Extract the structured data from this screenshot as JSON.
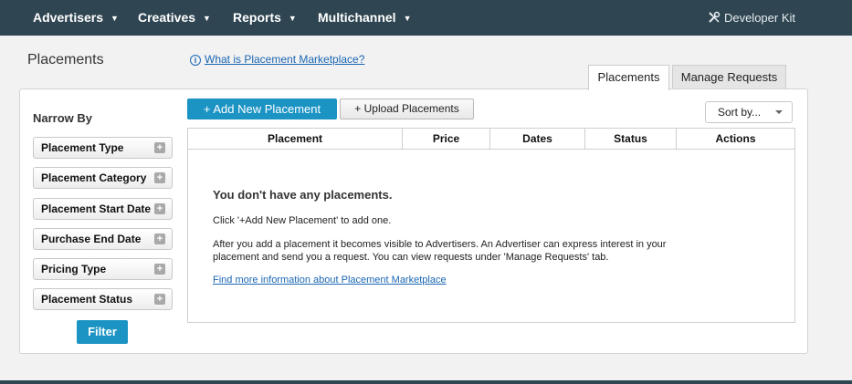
{
  "nav": {
    "items": [
      {
        "label": "Advertisers"
      },
      {
        "label": "Creatives"
      },
      {
        "label": "Reports"
      },
      {
        "label": "Multichannel"
      }
    ],
    "caret": "▼",
    "developer_kit": "Developer Kit"
  },
  "page": {
    "title": "Placements",
    "help_link": "What is Placement Marketplace?"
  },
  "tabs": [
    {
      "label": "Placements",
      "active": true
    },
    {
      "label": "Manage Requests",
      "active": false
    }
  ],
  "sidebar": {
    "title": "Narrow By",
    "filters": [
      {
        "label": "Placement Type"
      },
      {
        "label": "Placement Category"
      },
      {
        "label": "Placement Start Date"
      },
      {
        "label": "Purchase End Date"
      },
      {
        "label": "Pricing Type"
      },
      {
        "label": "Placement Status"
      }
    ],
    "plus": "+",
    "filter_button": "Filter"
  },
  "toolbar": {
    "add_button": "+ Add New Placement",
    "upload_button": "+ Upload Placements",
    "sort_label": "Sort by..."
  },
  "table": {
    "columns": [
      "Placement",
      "Price",
      "Dates",
      "Status",
      "Actions"
    ]
  },
  "empty_state": {
    "title": "You don't have any placements.",
    "line1": "Click '+Add New Placement' to add one.",
    "line2a": "After you add a placement it becomes visible to Advertisers. An Advertiser can express interest in your",
    "line2b": "placement and send you a request. You can view requests under 'Manage Requests' tab.",
    "link": "Find more information about Placement Marketplace"
  },
  "colors": {
    "nav_bg": "#2f4552",
    "accent": "#1b94c4",
    "link": "#1a66b4"
  }
}
